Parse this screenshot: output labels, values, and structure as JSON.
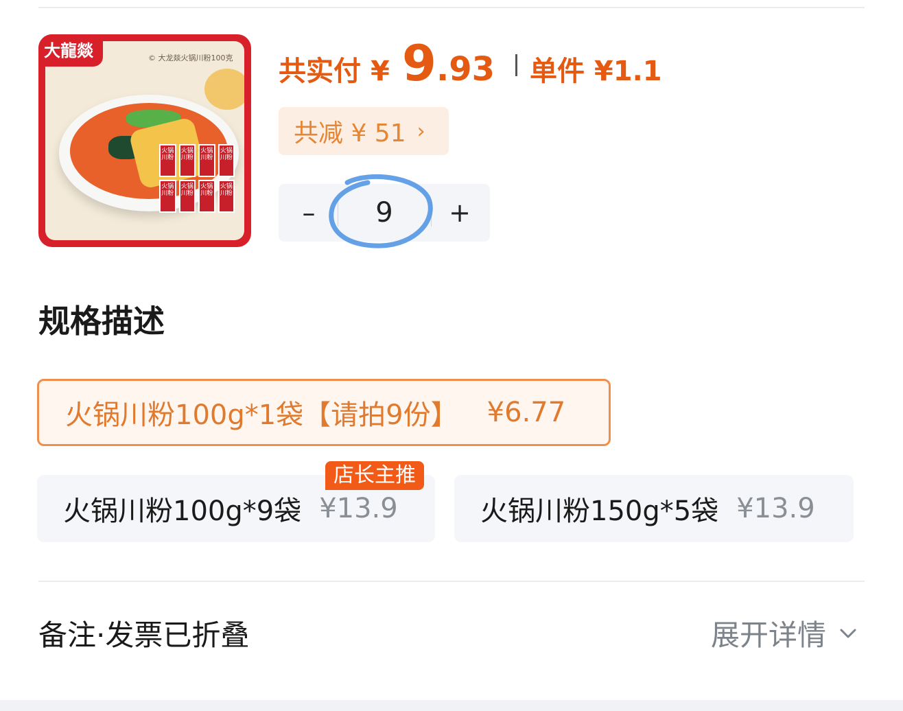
{
  "product": {
    "image_brand": "大龍燚",
    "image_caption": "© 大龙燚火锅川粉100克",
    "pack_label": "火锅川粉"
  },
  "price": {
    "total_label": "共实付",
    "currency": "¥",
    "total_int": "9",
    "total_dec": ".93",
    "unit_label": "单件 ¥1.1"
  },
  "discount": {
    "label": "共减 ¥ 51",
    "chevron": "›"
  },
  "quantity": {
    "minus": "–",
    "value": "9",
    "plus": "+"
  },
  "spec": {
    "title": "规格描述",
    "options": [
      {
        "name": "火锅川粉100g*1袋【请拍9份】",
        "price": "¥6.77",
        "selected": true
      },
      {
        "name": "火锅川粉100g*9袋",
        "price": "¥13.9",
        "selected": false,
        "badge": "店长主推"
      },
      {
        "name": "火锅川粉150g*5袋",
        "price": "¥13.9",
        "selected": false
      }
    ]
  },
  "notes": {
    "label": "备注·发票已折叠",
    "expand_label": "展开详情"
  },
  "colors": {
    "accent": "#e55a12",
    "discount_text": "#e58634",
    "badge": "#f25a18",
    "selected_border": "#f08e4b",
    "annotation_circle": "#4a90e2"
  }
}
